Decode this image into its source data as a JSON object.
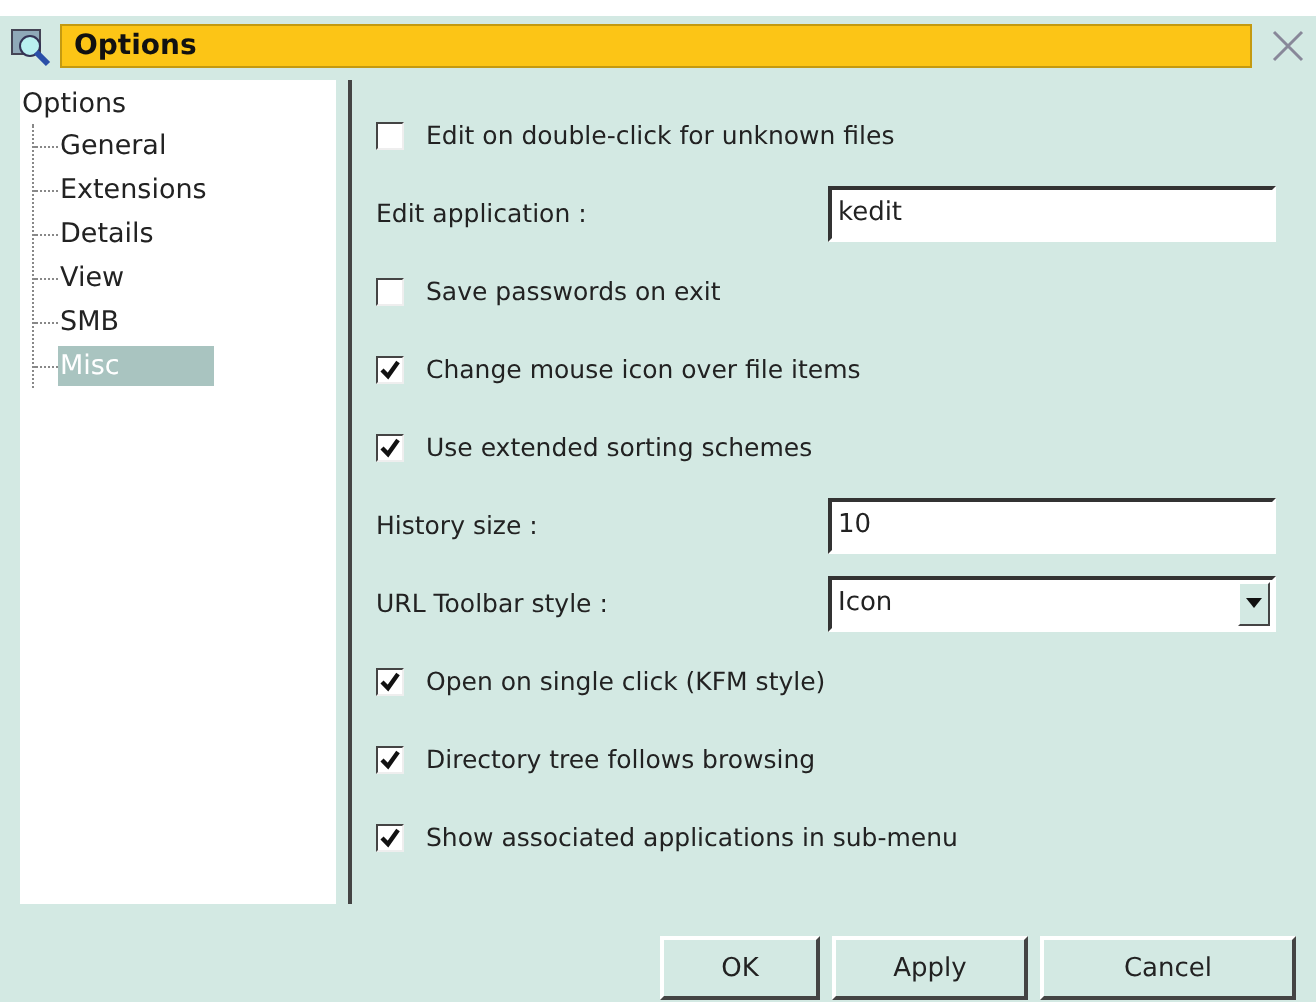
{
  "window": {
    "title": "Options"
  },
  "tree": {
    "label": "Options",
    "children": [
      {
        "label": "General",
        "selected": false
      },
      {
        "label": "Extensions",
        "selected": false
      },
      {
        "label": "Details",
        "selected": false
      },
      {
        "label": "View",
        "selected": false
      },
      {
        "label": "SMB",
        "selected": false
      },
      {
        "label": "Misc",
        "selected": true
      }
    ]
  },
  "settings": [
    {
      "kind": "checkbox",
      "label": "Edit on double-click for unknown files",
      "checked": false
    },
    {
      "kind": "text",
      "label": "Edit application :",
      "value": "kedit"
    },
    {
      "kind": "checkbox",
      "label": "Save passwords on exit",
      "checked": false
    },
    {
      "kind": "checkbox",
      "label": "Change mouse icon over file items",
      "checked": true
    },
    {
      "kind": "checkbox",
      "label": "Use extended sorting schemes",
      "checked": true
    },
    {
      "kind": "text",
      "label": "History size :",
      "value": "10"
    },
    {
      "kind": "combo",
      "label": "URL Toolbar style :",
      "value": "Icon"
    },
    {
      "kind": "checkbox",
      "label": "Open on single click (KFM style)",
      "checked": true
    },
    {
      "kind": "checkbox",
      "label": "Directory tree follows browsing",
      "checked": true
    },
    {
      "kind": "checkbox",
      "label": "Show associated applications in sub-menu",
      "checked": true
    }
  ],
  "buttons": [
    "OK",
    "Apply",
    "Cancel"
  ]
}
